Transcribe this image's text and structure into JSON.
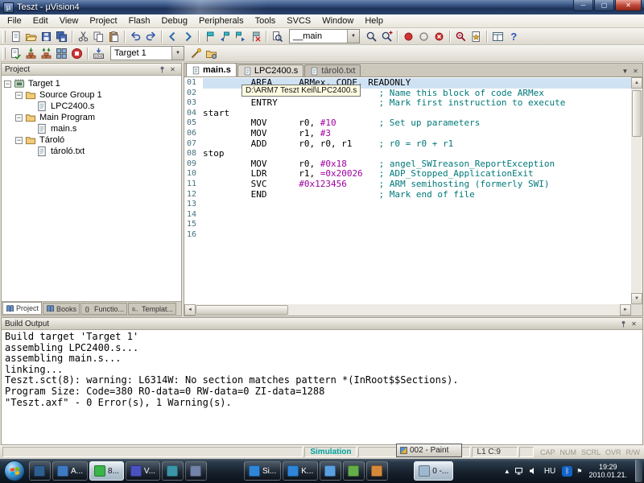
{
  "window": {
    "title": "Teszt - µVision4",
    "controls": {
      "minimize": "─",
      "maximize": "▢",
      "close": "✕"
    }
  },
  "menu": {
    "items": [
      "File",
      "Edit",
      "View",
      "Project",
      "Flash",
      "Debug",
      "Peripherals",
      "Tools",
      "SVCS",
      "Window",
      "Help"
    ]
  },
  "toolbars": {
    "row1_left": [
      "new",
      "open",
      "save",
      "save-all",
      "|",
      "cut",
      "copy",
      "paste",
      "|",
      "undo",
      "redo",
      "|",
      "navigate-back",
      "navigate-forward",
      "|",
      "bookmark",
      "bookmark-prev",
      "bookmark-next",
      "bookmark-clear",
      "|",
      "find-in-files"
    ],
    "find_combo_value": "__main",
    "row1_right": [
      "find",
      "incremental-find",
      "|",
      "breakpoint",
      "breakpoint-disable",
      "breakpoint-kill",
      "|",
      "debug",
      "insert-template",
      "|",
      "window-layout",
      "help"
    ],
    "row2_left": [
      "translate",
      "build",
      "rebuild",
      "batch-build",
      "stop-build",
      "|",
      "load-flash"
    ],
    "target_combo_value": "Target 1",
    "row2_right": [
      "options",
      "manage-components"
    ]
  },
  "project_panel": {
    "title": "Project",
    "tree": [
      {
        "label": "Target 1",
        "level": 0,
        "icon": "target",
        "expandable": true
      },
      {
        "label": "Source Group 1",
        "level": 1,
        "icon": "folder",
        "expandable": true
      },
      {
        "label": "LPC2400.s",
        "level": 2,
        "icon": "file"
      },
      {
        "label": "Main Program",
        "level": 1,
        "icon": "folder",
        "expandable": true
      },
      {
        "label": "main.s",
        "level": 2,
        "icon": "file"
      },
      {
        "label": "Tároló",
        "level": 1,
        "icon": "folder",
        "expandable": true
      },
      {
        "label": "tároló.txt",
        "level": 2,
        "icon": "file"
      }
    ],
    "tabs": [
      {
        "label": "Project",
        "icon": "book",
        "active": true
      },
      {
        "label": "Books",
        "icon": "book"
      },
      {
        "label": "Functio...",
        "icon": "braces"
      },
      {
        "label": "Templat...",
        "icon": "templates"
      }
    ]
  },
  "editor": {
    "tabs": [
      {
        "label": "main.s",
        "state": "active"
      },
      {
        "label": "LPC2400.s",
        "state": "normal"
      },
      {
        "label": "tároló.txt",
        "state": "dim"
      }
    ],
    "tooltip": "D:\\ARM7 Teszt Keil\\LPC2400.s",
    "lines": [
      {
        "n": "01",
        "sel": true,
        "segs": [
          [
            "p",
            "         AREA     ARMex, CODE, READONLY"
          ]
        ]
      },
      {
        "n": "02",
        "segs": [
          [
            "p",
            "                                 "
          ],
          [
            "c",
            "; Name this block of code ARMex"
          ]
        ]
      },
      {
        "n": "03",
        "segs": [
          [
            "p",
            "         ENTRY                   "
          ],
          [
            "c",
            "; Mark first instruction to execute"
          ]
        ]
      },
      {
        "n": "04",
        "segs": [
          [
            "p",
            "start"
          ]
        ]
      },
      {
        "n": "05",
        "segs": [
          [
            "p",
            "         MOV      r0, "
          ],
          [
            "num",
            "#10"
          ],
          [
            "p",
            "        "
          ],
          [
            "c",
            "; Set up parameters"
          ]
        ]
      },
      {
        "n": "06",
        "segs": [
          [
            "p",
            "         MOV      r1, "
          ],
          [
            "num",
            "#3"
          ]
        ]
      },
      {
        "n": "07",
        "segs": [
          [
            "p",
            "         ADD      r0, r0, r1     "
          ],
          [
            "c",
            "; r0 = r0 + r1"
          ]
        ]
      },
      {
        "n": "08",
        "segs": [
          [
            "p",
            "stop"
          ]
        ]
      },
      {
        "n": "09",
        "segs": [
          [
            "p",
            "         MOV      r0, "
          ],
          [
            "num",
            "#0x18"
          ],
          [
            "p",
            "      "
          ],
          [
            "c",
            "; angel_SWIreason_ReportException"
          ]
        ]
      },
      {
        "n": "10",
        "segs": [
          [
            "p",
            "         LDR      r1, "
          ],
          [
            "num",
            "=0x20026"
          ],
          [
            "p",
            "   "
          ],
          [
            "c",
            "; ADP_Stopped_ApplicationExit"
          ]
        ]
      },
      {
        "n": "11",
        "segs": [
          [
            "p",
            "         SVC      "
          ],
          [
            "num",
            "#0x123456"
          ],
          [
            "p",
            "      "
          ],
          [
            "c",
            "; ARM semihosting (formerly SWI)"
          ]
        ]
      },
      {
        "n": "12",
        "segs": [
          [
            "p",
            "         END                     "
          ],
          [
            "c",
            "; Mark end of file"
          ]
        ]
      },
      {
        "n": "13",
        "segs": []
      },
      {
        "n": "14",
        "segs": []
      },
      {
        "n": "15",
        "segs": []
      },
      {
        "n": "16",
        "segs": []
      }
    ]
  },
  "build_output": {
    "title": "Build Output",
    "lines": [
      "Build target 'Target 1'",
      "assembling LPC2400.s...",
      "assembling main.s...",
      "linking...",
      "Teszt.sct(8): warning: L6314W: No section matches pattern *(InRoot$$Sections).",
      "Program Size: Code=380 RO-data=0 RW-data=0 ZI-data=1288",
      "\"Teszt.axf\" - 0 Error(s), 1 Warning(s)."
    ]
  },
  "status_bar": {
    "mode": "Simulation",
    "cursor": "L1 C:9",
    "flags": [
      "CAP",
      "NUM",
      "SCRL",
      "OVR",
      "R/W"
    ]
  },
  "overlay_window": {
    "title": "002 - Paint"
  },
  "taskbar": {
    "items": [
      {
        "label": "",
        "color": "#2e5f8f"
      },
      {
        "label": "A...",
        "color": "#3f7ac0"
      },
      {
        "label": "8...",
        "color": "#39b54a",
        "pressed": true
      },
      {
        "label": "V...",
        "color": "#4a52c0"
      },
      {
        "label": "",
        "color": "#3a95a8"
      },
      {
        "label": "",
        "color": "#7282a8"
      },
      {
        "label": "Si...",
        "color": "#2f86d8"
      },
      {
        "label": "K...",
        "color": "#2f86d8"
      },
      {
        "label": "",
        "color": "#5aa0e0"
      },
      {
        "label": "",
        "color": "#64ad49"
      },
      {
        "label": "",
        "color": "#d5883a"
      },
      {
        "label": "0 -...",
        "color": "#9db8cf",
        "pressed": true
      }
    ],
    "tray": {
      "language": "HU",
      "time": "19:29",
      "date": "2010.01.21."
    }
  },
  "colors": {
    "comment": "#007878",
    "number": "#a000a0",
    "selection": "#cfe2f4",
    "mode_text": "#00a0a0",
    "titlebar": "#2b4572"
  }
}
